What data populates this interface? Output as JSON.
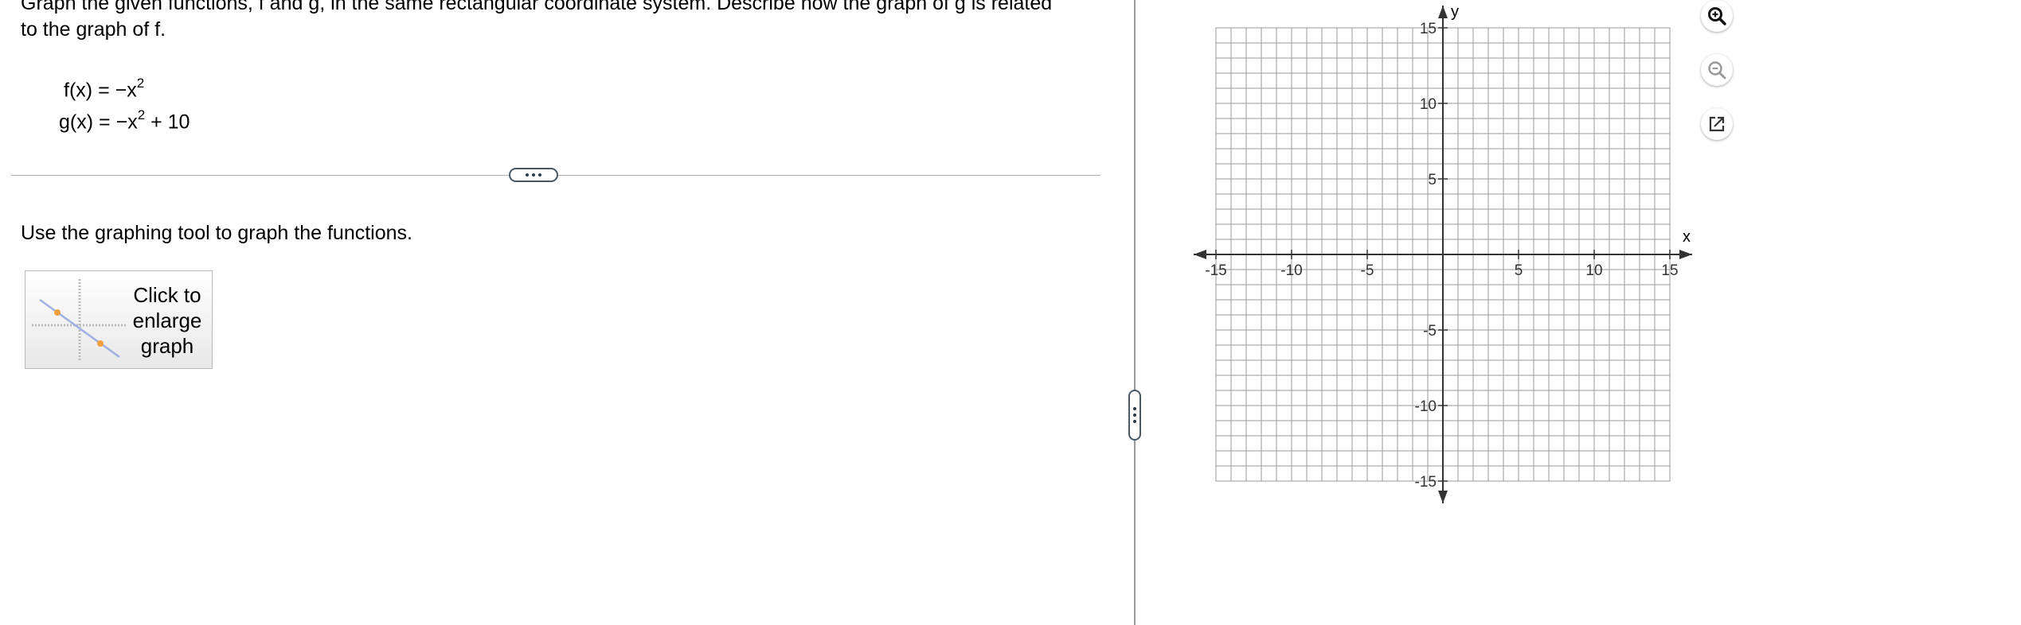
{
  "problem": {
    "text": "Graph the given functions, f and g, in the same rectangular coordinate system. Describe how the graph of g is related to the graph of f."
  },
  "functions": {
    "f": {
      "lhs": "f(x)",
      "eq": "=",
      "neg": "−",
      "var": "x",
      "exp": "2",
      "tail": ""
    },
    "g": {
      "lhs": "g(x)",
      "eq": "=",
      "neg": "−",
      "var": "x",
      "exp": "2",
      "tail": " + 10"
    }
  },
  "instruction": "Use the graphing tool to graph the functions.",
  "enlarge_button": {
    "label": "Click to\nenlarge\ngraph"
  },
  "graph": {
    "x_axis_label": "x",
    "y_axis_label": "y",
    "range": {
      "xmin": -15,
      "xmax": 15,
      "ymin": -15,
      "ymax": 15
    },
    "grid_step": 1,
    "x_tick_labels": [
      "-15",
      "-10",
      "-5",
      "5",
      "10",
      "15"
    ],
    "y_tick_labels": [
      "15",
      "10",
      "5",
      "-5",
      "-10",
      "-15"
    ],
    "grid_color": "#9a9a9a",
    "axis_color": "#333333"
  },
  "toolbar": {
    "zoom_in_icon": "zoom-in-icon",
    "zoom_out_icon": "zoom-out-icon",
    "popout_icon": "external-link-icon"
  }
}
